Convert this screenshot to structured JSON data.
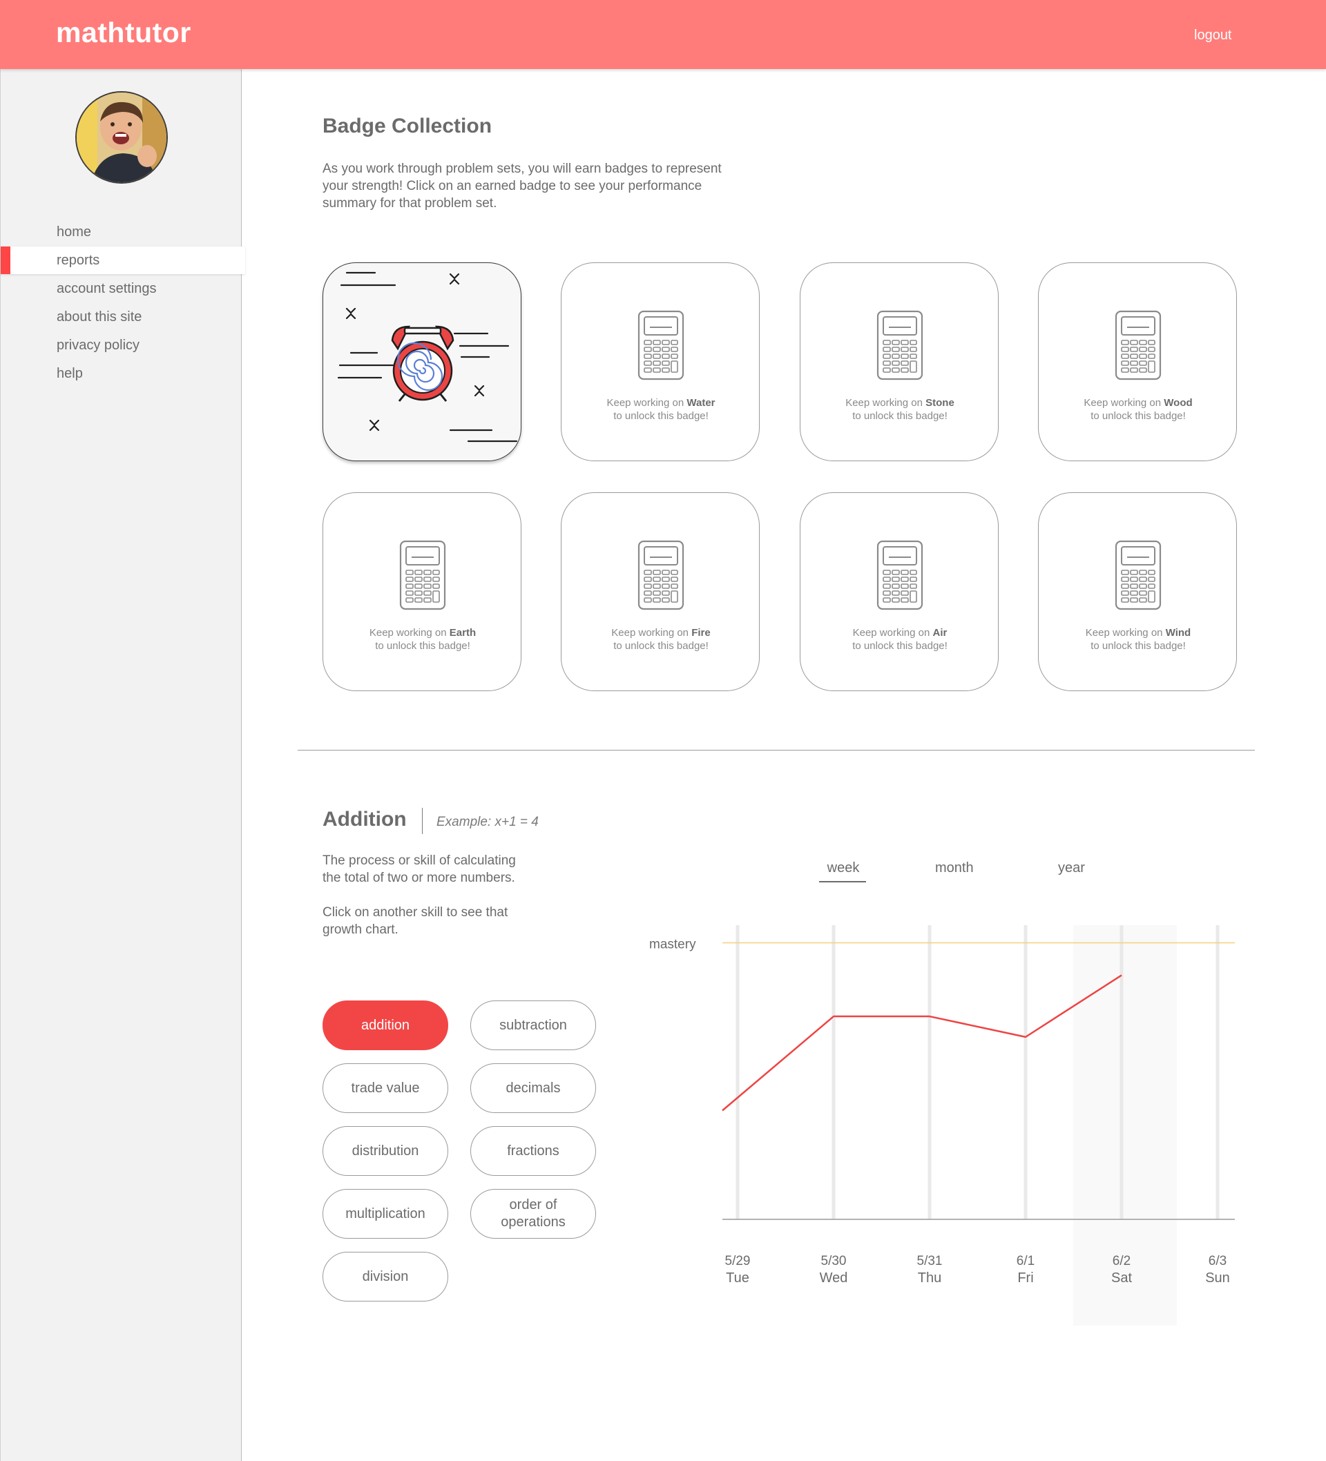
{
  "app": {
    "brand": "mathtutor",
    "logout_label": "logout"
  },
  "sidebar": {
    "items": [
      {
        "label": "home"
      },
      {
        "label": "reports",
        "active": true
      },
      {
        "label": "account settings"
      },
      {
        "label": "about this site"
      },
      {
        "label": "privacy policy"
      },
      {
        "label": "help"
      }
    ]
  },
  "badges": {
    "title": "Badge Collection",
    "description_lines": [
      "As you work through problem sets, you will earn badges to represent",
      "your strength! Click on an earned badge to see your performance",
      "summary for that problem set."
    ],
    "locked_prefix": "Keep working on",
    "locked_suffix": "to unlock this badge!",
    "items": [
      {
        "status": "earned",
        "icon": "alarm-clock-icon"
      },
      {
        "name": "Water",
        "status": "locked",
        "icon": "calculator-icon"
      },
      {
        "name": "Stone",
        "status": "locked",
        "icon": "calculator-icon"
      },
      {
        "name": "Wood",
        "status": "locked",
        "icon": "calculator-icon"
      },
      {
        "name": "Earth",
        "status": "locked",
        "icon": "calculator-icon"
      },
      {
        "name": "Fire",
        "status": "locked",
        "icon": "calculator-icon"
      },
      {
        "name": "Air",
        "status": "locked",
        "icon": "calculator-icon"
      },
      {
        "name": "Wind",
        "status": "locked",
        "icon": "calculator-icon"
      }
    ]
  },
  "skill": {
    "title": "Addition",
    "example": "Example: x+1 = 4",
    "description_lines": [
      "The process or skill of calculating",
      "the total of two or more numbers."
    ],
    "hint_lines": [
      "Click on another skill to see that",
      "growth chart."
    ],
    "buttons": [
      {
        "label": "addition",
        "active": true
      },
      {
        "label": "subtraction"
      },
      {
        "label": "trade value"
      },
      {
        "label": "decimals"
      },
      {
        "label": "distribution"
      },
      {
        "label": "fractions"
      },
      {
        "label": "multiplication"
      },
      {
        "label": "order of operations"
      },
      {
        "label": "division"
      }
    ]
  },
  "range_tabs": [
    {
      "label": "week",
      "active": true
    },
    {
      "label": "month"
    },
    {
      "label": "year"
    }
  ],
  "colors": {
    "brand": "#ff7c7a",
    "accent": "#f24646",
    "mastery_line": "#f3d27a"
  },
  "chart_data": {
    "type": "line",
    "x": [
      "5/29 Tue",
      "5/30 Wed",
      "5/31 Thu",
      "6/1 Fri",
      "6/2 Sat",
      "6/3 Sun"
    ],
    "x_dates": [
      "5/29",
      "5/30",
      "5/31",
      "6/1",
      "6/2",
      "6/3"
    ],
    "x_days": [
      "Tue",
      "Wed",
      "Thu",
      "Fri",
      "Sat",
      "Sun"
    ],
    "series": [
      {
        "values": [
          0.37,
          0.69,
          0.69,
          0.62,
          0.83,
          null
        ]
      }
    ],
    "mastery_label": "mastery",
    "mastery_value": 0.94,
    "highlighted_category": "6/2 Sat",
    "ylim": [
      0,
      1
    ]
  }
}
